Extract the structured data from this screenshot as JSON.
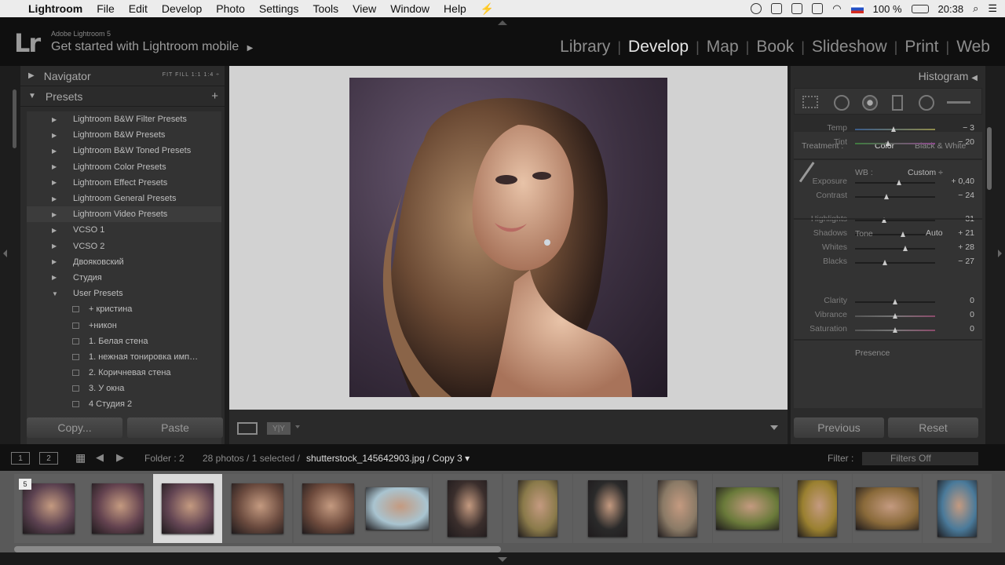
{
  "menubar": {
    "app": "Lightroom",
    "items": [
      "File",
      "Edit",
      "Develop",
      "Photo",
      "Settings",
      "Tools",
      "View",
      "Window",
      "Help"
    ],
    "battery": "100 %",
    "time": "20:38"
  },
  "header": {
    "version": "Adobe Lightroom 5",
    "mobile": "Get started with Lightroom mobile",
    "modules": [
      "Library",
      "Develop",
      "Map",
      "Book",
      "Slideshow",
      "Print",
      "Web"
    ],
    "active_module": "Develop"
  },
  "left": {
    "navigator": "Navigator",
    "nav_zoom": "FIT   FILL   1:1   1:4 ÷",
    "presets": "Presets",
    "presets_add": "+",
    "list": [
      {
        "kind": "folder",
        "label": "Lightroom B&W Filter Presets",
        "arrow": "▶"
      },
      {
        "kind": "folder",
        "label": "Lightroom B&W Presets",
        "arrow": "▶"
      },
      {
        "kind": "folder",
        "label": "Lightroom B&W Toned Presets",
        "arrow": "▶"
      },
      {
        "kind": "folder",
        "label": "Lightroom Color Presets",
        "arrow": "▶"
      },
      {
        "kind": "folder",
        "label": "Lightroom Effect Presets",
        "arrow": "▶"
      },
      {
        "kind": "folder",
        "label": "Lightroom General Presets",
        "arrow": "▶"
      },
      {
        "kind": "folder",
        "label": "Lightroom Video Presets",
        "arrow": "▶"
      },
      {
        "kind": "folder",
        "label": "VCSO 1",
        "arrow": "▶"
      },
      {
        "kind": "folder",
        "label": "VCSO 2",
        "arrow": "▶"
      },
      {
        "kind": "folder",
        "label": "Двояковский",
        "arrow": "▶"
      },
      {
        "kind": "folder",
        "label": "Студия",
        "arrow": "▶"
      },
      {
        "kind": "folder",
        "label": "User Presets",
        "arrow": "▼"
      },
      {
        "kind": "item",
        "label": "+ кристина"
      },
      {
        "kind": "item",
        "label": "+никон"
      },
      {
        "kind": "item",
        "label": "1. Белая стена"
      },
      {
        "kind": "item",
        "label": "1. нежная тонировка имп…"
      },
      {
        "kind": "item",
        "label": "2. Коричневая стена"
      },
      {
        "kind": "item",
        "label": "3. У окна"
      },
      {
        "kind": "item",
        "label": "4 Студия 2"
      }
    ],
    "copy": "Copy...",
    "paste": "Paste"
  },
  "right": {
    "histogram": "Histogram",
    "treatment_label": "Treatment :",
    "treatment_color": "Color",
    "treatment_bw": "Black & White",
    "wb_label": "WB :",
    "wb_value": "Custom ÷",
    "tone": "Tone",
    "auto": "Auto",
    "presence": "Presence",
    "sliders": [
      {
        "label": "Temp",
        "value": "− 3",
        "pos": 0.49
      },
      {
        "label": "Tint",
        "value": "− 20",
        "pos": 0.42
      },
      {
        "label": "Exposure",
        "value": "+ 0,40",
        "pos": 0.55
      },
      {
        "label": "Contrast",
        "value": "− 24",
        "pos": 0.4
      },
      {
        "label": "Highlights",
        "value": "− 31",
        "pos": 0.37
      },
      {
        "label": "Shadows",
        "value": "+ 21",
        "pos": 0.6
      },
      {
        "label": "Whites",
        "value": "+ 28",
        "pos": 0.63
      },
      {
        "label": "Blacks",
        "value": "− 27",
        "pos": 0.38
      },
      {
        "label": "Clarity",
        "value": "0",
        "pos": 0.5
      },
      {
        "label": "Vibrance",
        "value": "0",
        "pos": 0.5
      },
      {
        "label": "Saturation",
        "value": "0",
        "pos": 0.5
      }
    ],
    "previous": "Previous",
    "reset": "Reset"
  },
  "filmstrip_bar": {
    "view1": "1",
    "view2": "2",
    "folder": "Folder : 2",
    "count": "28 photos / 1 selected /",
    "filename": "shutterstock_145642903.jpg / Copy 3 ▾",
    "filter_label": "Filter :",
    "filter_value": "Filters Off"
  },
  "filmstrip": {
    "stack_count": "5"
  },
  "colors": {
    "accent": "#e6e6e6",
    "panel": "#2b2b2b",
    "viewer_bg": "#d2d2d2"
  }
}
